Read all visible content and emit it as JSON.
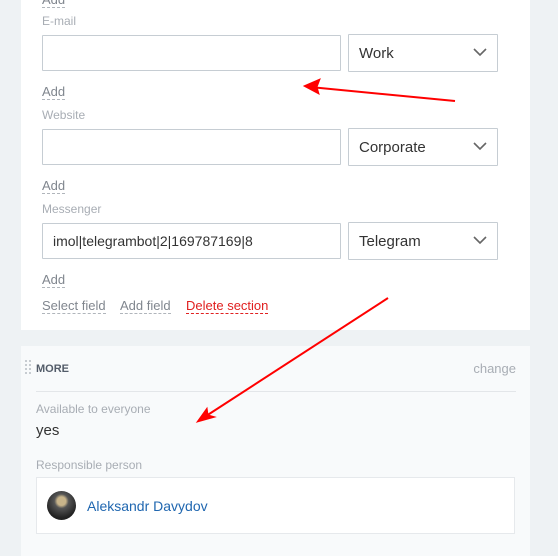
{
  "fields": [
    {
      "label": "E-mail",
      "value": "",
      "type": "Work",
      "add": "Add"
    },
    {
      "label": "Website",
      "value": "",
      "type": "Corporate",
      "add": "Add"
    },
    {
      "label": "Messenger",
      "value": "imol|telegrambot|2|169787169|8",
      "type": "Telegram",
      "add": "Add"
    }
  ],
  "top_add": "Add",
  "actions": {
    "select_field": "Select field",
    "add_field": "Add field",
    "delete_section": "Delete section"
  },
  "more": {
    "title": "MORE",
    "change": "change",
    "available_label": "Available to everyone",
    "available_value": "yes",
    "responsible_label": "Responsible person",
    "responsible_name": "Aleksandr Davydov"
  },
  "colors": {
    "accent": "#2067b0",
    "danger": "#e02020",
    "annotation": "#ff0000"
  }
}
